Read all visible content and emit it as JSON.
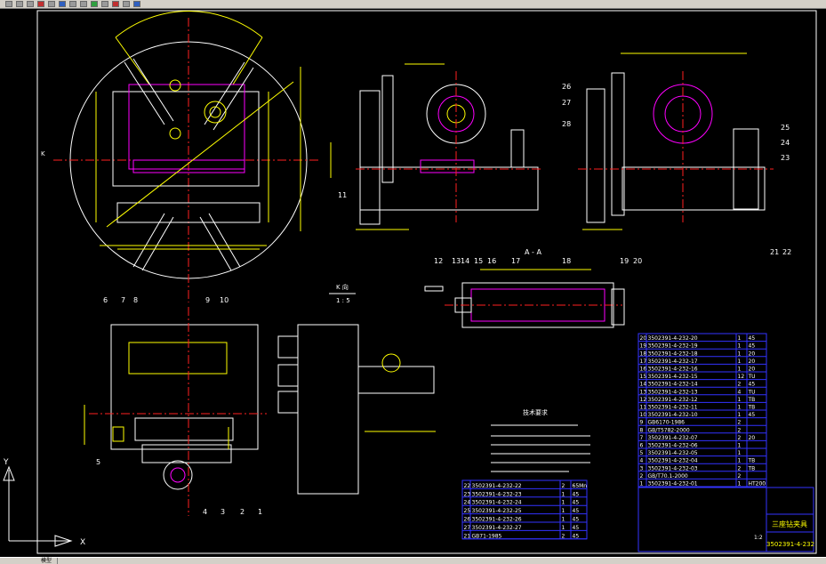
{
  "drawing": {
    "ucs": {
      "y_label": "Y",
      "x_label": "X"
    },
    "view_label_k": "K",
    "section_label": "A - A",
    "detail_label": "K 向",
    "detail_scale": "1 : 5",
    "notes_title": "技术要求",
    "parts_table_left": [
      {
        "no": "22",
        "code": "3502391-4-232-22",
        "qty": "2",
        "mat": "65Mn"
      },
      {
        "no": "23",
        "code": "3502391-4-232-23",
        "qty": "1",
        "mat": "45"
      },
      {
        "no": "24",
        "code": "3502391-4-232-24",
        "qty": "1",
        "mat": "45"
      },
      {
        "no": "25",
        "code": "3502391-4-232-25",
        "qty": "1",
        "mat": "45"
      },
      {
        "no": "26",
        "code": "3502391-4-232-26",
        "qty": "1",
        "mat": "45"
      },
      {
        "no": "27",
        "code": "3502391-4-232-27",
        "qty": "1",
        "mat": "45"
      },
      {
        "no": "21",
        "code": "GB71-1985",
        "qty": "2",
        "mat": "45"
      }
    ],
    "parts_table_right": [
      {
        "no": "20",
        "code": "3502391-4-232-20",
        "qty": "1",
        "mat": "45"
      },
      {
        "no": "19",
        "code": "3502391-4-232-19",
        "qty": "1",
        "mat": "45"
      },
      {
        "no": "18",
        "code": "3502391-4-232-18",
        "qty": "1",
        "mat": "20"
      },
      {
        "no": "17",
        "code": "3502391-4-232-17",
        "qty": "1",
        "mat": "20"
      },
      {
        "no": "16",
        "code": "3502391-4-232-16",
        "qty": "1",
        "mat": "20"
      },
      {
        "no": "15",
        "code": "3502391-4-232-15",
        "qty": "12",
        "mat": "TU"
      },
      {
        "no": "14",
        "code": "3502391-4-232-14",
        "qty": "2",
        "mat": "45"
      },
      {
        "no": "13",
        "code": "3502391-4-232-13",
        "qty": "4",
        "mat": "TU"
      },
      {
        "no": "12",
        "code": "3502391-4-232-12",
        "qty": "1",
        "mat": "TB"
      },
      {
        "no": "11",
        "code": "3502391-4-232-11",
        "qty": "1",
        "mat": "TB"
      },
      {
        "no": "10",
        "code": "3502391-4-232-10",
        "qty": "1",
        "mat": "45"
      },
      {
        "no": "9",
        "code": "GB6170-1986",
        "qty": "2",
        "mat": ""
      },
      {
        "no": "8",
        "code": "GB/T5782-2000",
        "qty": "2",
        "mat": ""
      },
      {
        "no": "7",
        "code": "3502391-4-232-07",
        "qty": "2",
        "mat": "20"
      },
      {
        "no": "6",
        "code": "3502391-4-232-06",
        "qty": "1",
        "mat": ""
      },
      {
        "no": "5",
        "code": "3502391-4-232-05",
        "qty": "1",
        "mat": ""
      },
      {
        "no": "4",
        "code": "3502391-4-232-04",
        "qty": "1",
        "mat": "TB"
      },
      {
        "no": "3",
        "code": "3502391-4-232-03",
        "qty": "2",
        "mat": "TB"
      },
      {
        "no": "2",
        "code": "GB/T70.1-2000",
        "qty": "2",
        "mat": ""
      },
      {
        "no": "1",
        "code": "3502391-4-232-01",
        "qty": "1",
        "mat": "HT200"
      }
    ],
    "title_block": {
      "name": "三座钻夹具",
      "drawing_no": "3502391-4-232",
      "scale": "1:2"
    },
    "balloons_left": [
      "6",
      "7",
      "8",
      "9",
      "10",
      "5",
      "4",
      "3",
      "2",
      "1"
    ],
    "balloons_right": [
      "12",
      "13",
      "14",
      "15",
      "16",
      "17",
      "18",
      "19",
      "20",
      "11",
      "26",
      "27",
      "28",
      "25",
      "24",
      "23",
      "21",
      "22"
    ]
  },
  "status": {
    "tab_model": "模型"
  },
  "colors": {
    "bg": "#000000",
    "yellow": "#ffff00",
    "red": "#ff2020",
    "magenta": "#ff00ff",
    "cyan": "#00ffff",
    "green": "#00ff00",
    "white": "#ffffff",
    "blue": "#3333ff"
  }
}
